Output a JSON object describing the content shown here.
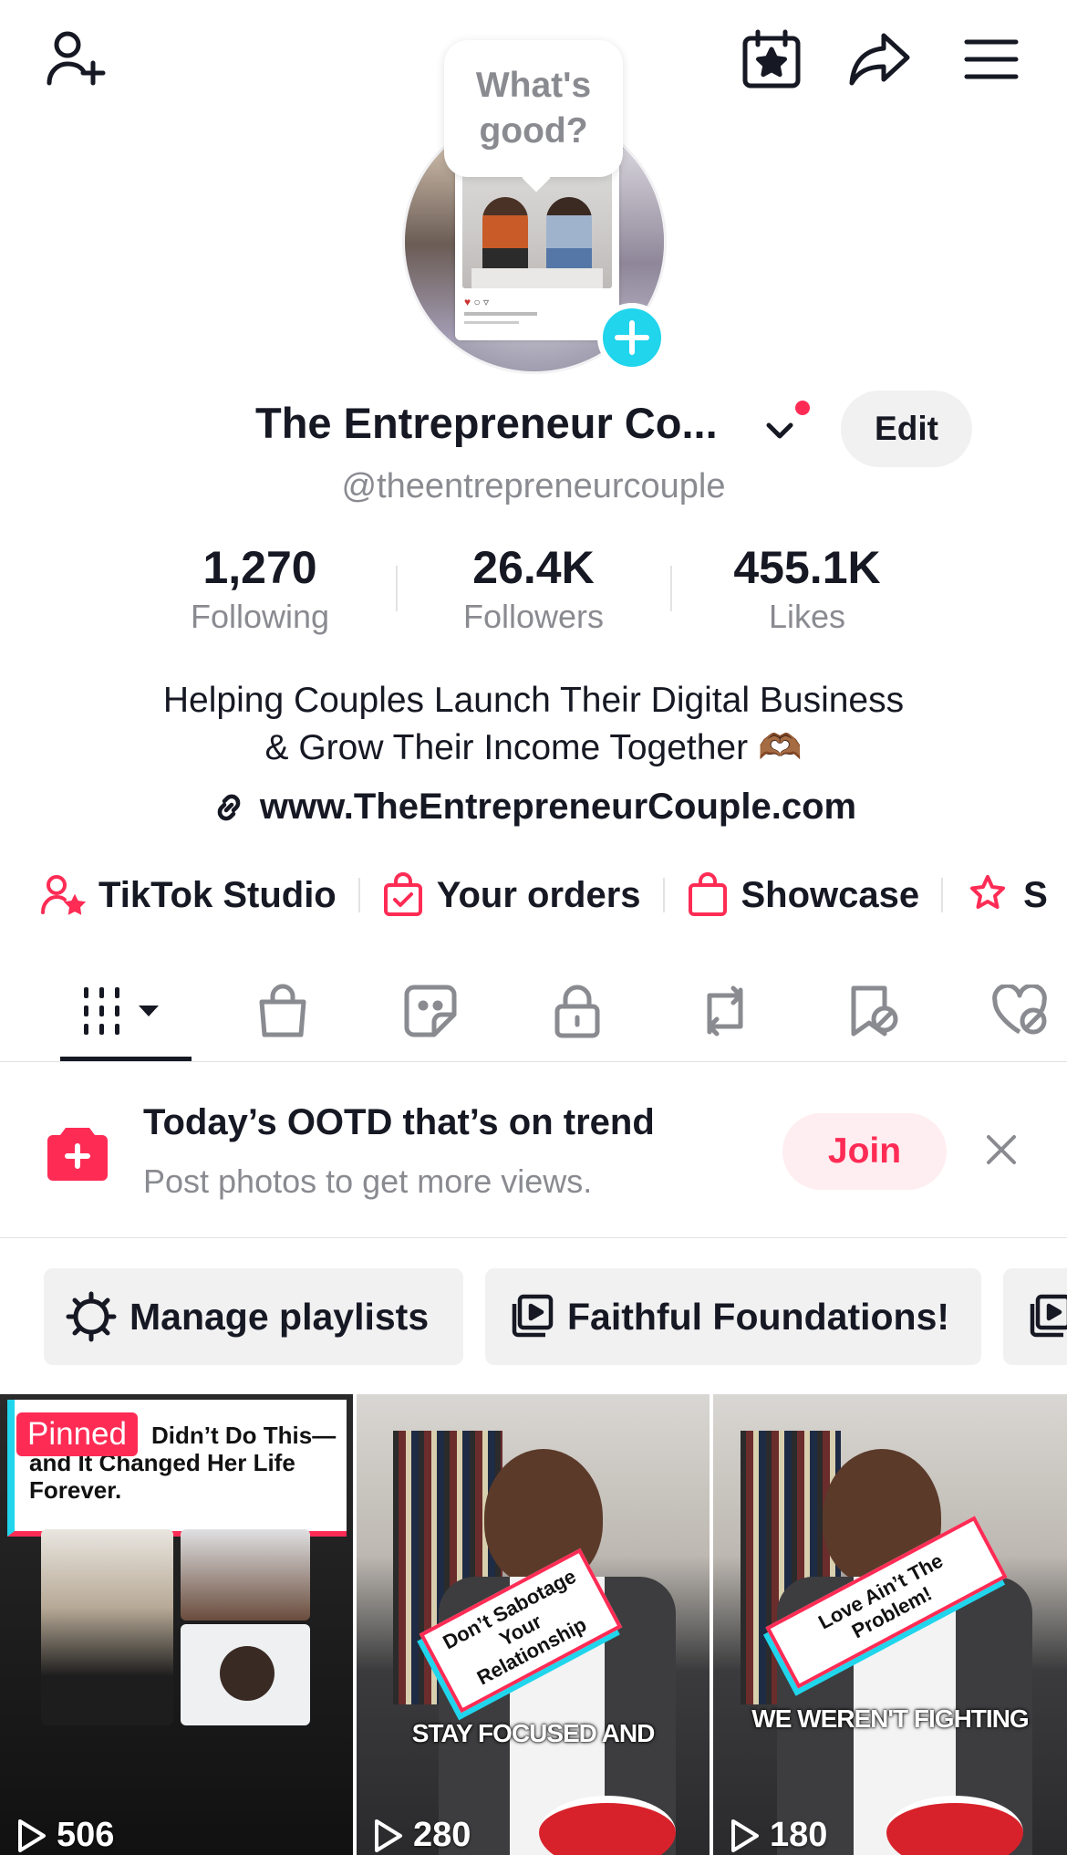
{
  "profile": {
    "avatar_bubble": "What's good?",
    "display_name": "The Entrepreneur Co...",
    "handle": "@theentrepreneurcouple",
    "edit_label": "Edit"
  },
  "stats": [
    {
      "value": "1,270",
      "label": "Following"
    },
    {
      "value": "26.4K",
      "label": "Followers"
    },
    {
      "value": "455.1K",
      "label": "Likes"
    }
  ],
  "bio": {
    "line1": "Helping Couples Launch Their Digital Business",
    "line2": "& Grow Their Income Together 🫶🏾",
    "link": "www.TheEntrepreneurCouple.com"
  },
  "quick_actions": [
    {
      "label": "TikTok Studio",
      "icon": "creator-star-icon"
    },
    {
      "label": "Your orders",
      "icon": "order-bag-icon"
    },
    {
      "label": "Showcase",
      "icon": "shopping-bag-icon"
    },
    {
      "label": "S",
      "icon": "star-ribbon-icon"
    }
  ],
  "tabs": [
    "videos-grid-icon",
    "shop-bag-icon",
    "sticker-icon",
    "lock-icon",
    "repost-icon",
    "favorites-hidden-icon",
    "liked-hidden-icon"
  ],
  "trend_banner": {
    "title": "Today’s OOTD that’s on trend",
    "subtitle": "Post photos to get more views.",
    "join_label": "Join"
  },
  "playlists": {
    "manage_label": "Manage playlists",
    "items": [
      "Faithful Foundations!"
    ]
  },
  "videos": [
    {
      "views": "506",
      "pinned": "Pinned",
      "caption_top": "Didn’t Do This—",
      "caption_mid": "and It Changed Her Life",
      "caption_bottom": "Forever."
    },
    {
      "views": "280",
      "tag_line1": "Don’t Sabotage",
      "tag_line2": "Your Relationship",
      "subtitle": "STAY FOCUSED AND"
    },
    {
      "views": "180",
      "tag_line1": "Love Ain’t The Problem!",
      "subtitle": "WE WEREN'T FIGHTING"
    }
  ],
  "colors": {
    "brand_red": "#fe2c55",
    "brand_cyan": "#20d5ec",
    "text_primary": "#161823",
    "text_secondary": "#8a8b91"
  }
}
